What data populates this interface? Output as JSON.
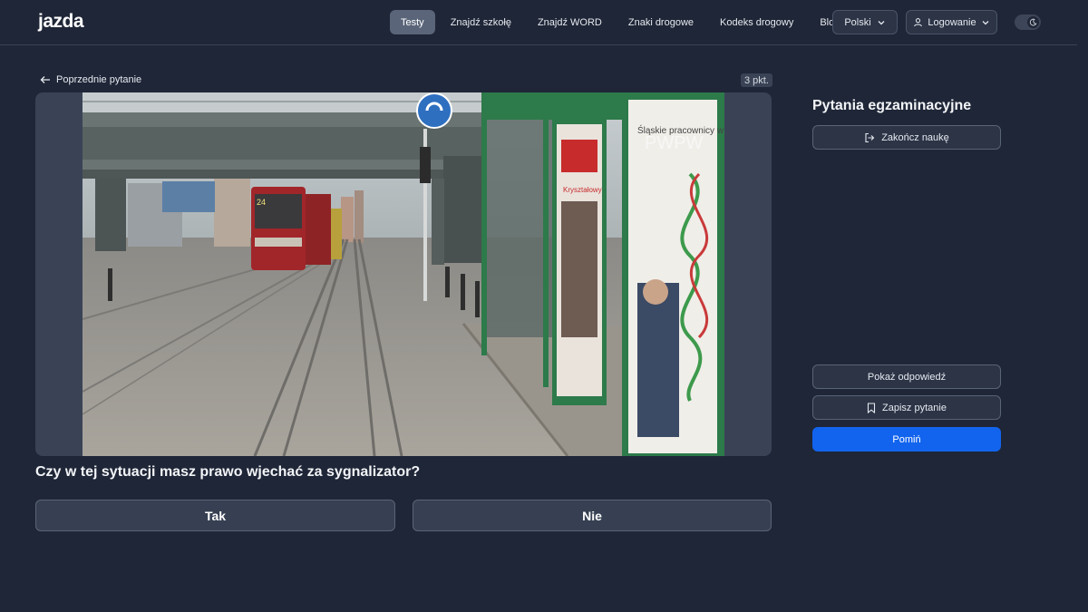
{
  "header": {
    "logo": "jazda",
    "nav": [
      {
        "label": "Testy",
        "active": true
      },
      {
        "label": "Znajdź szkołę",
        "active": false
      },
      {
        "label": "Znajdź WORD",
        "active": false
      },
      {
        "label": "Znaki drogowe",
        "active": false
      },
      {
        "label": "Kodeks drogowy",
        "active": false
      },
      {
        "label": "Blog",
        "active": false
      }
    ],
    "language": "Polski",
    "login": "Logowanie"
  },
  "main": {
    "prev_label": "Poprzednie pytanie",
    "points": "3 pkt.",
    "question": "Czy w tej sytuacji masz prawo wjechać za sygnalizator?",
    "answers": [
      "Tak",
      "Nie"
    ],
    "media": {
      "tram_number": "24",
      "poster_left": "Kryształowy",
      "poster_right": "Śląskie pracownicy w genach",
      "watermark": "PWPW"
    }
  },
  "panel": {
    "title": "Pytania egzaminacyjne",
    "finish_label": "Zakończ naukę",
    "show_answer_label": "Pokaż odpowiedź",
    "save_label": "Zapisz pytanie",
    "skip_label": "Pomiń"
  },
  "colors": {
    "background": "#1f2637",
    "accent": "#1264ee",
    "active_nav": "#5a6579"
  }
}
